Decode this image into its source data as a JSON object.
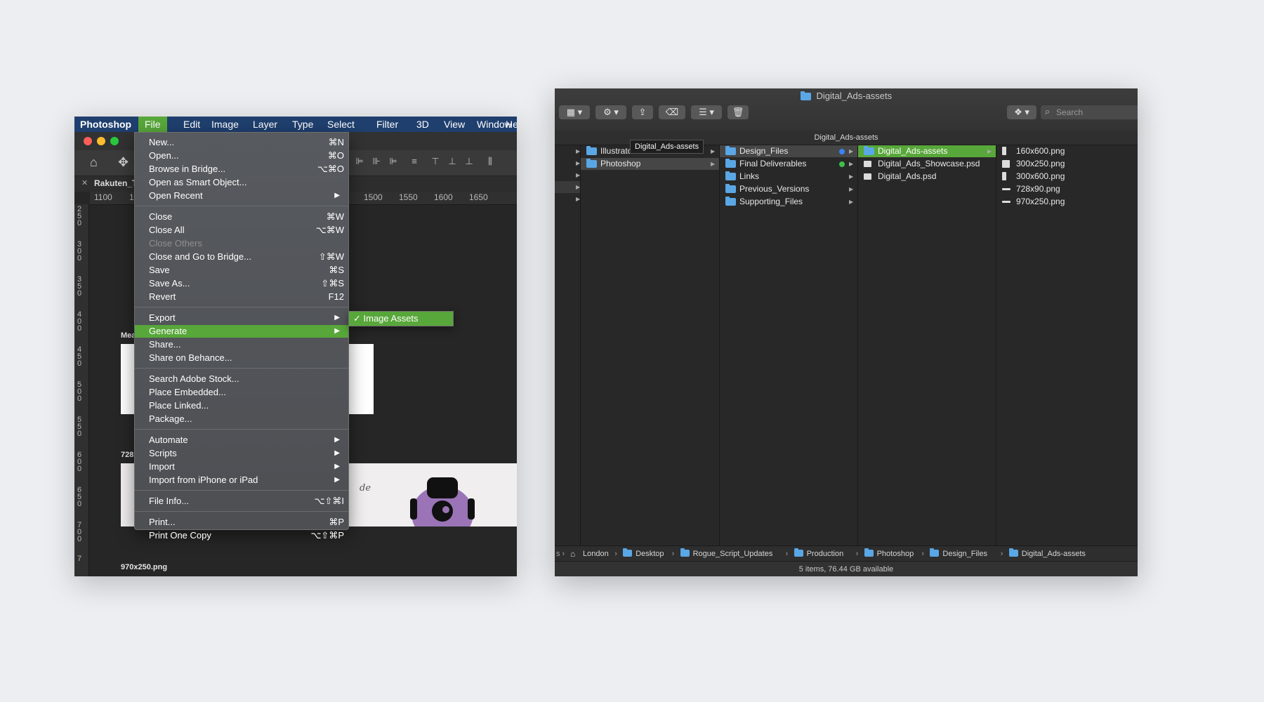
{
  "photoshop": {
    "menubar": [
      "Photoshop",
      "File",
      "Edit",
      "Image",
      "Layer",
      "Type",
      "Select",
      "Filter",
      "3D",
      "View",
      "Window",
      "He"
    ],
    "active_menu": "File",
    "document_tab": "Rakuten_Te",
    "ruler_h": [
      "1100",
      "115",
      "1500",
      "1550",
      "1600",
      "1650"
    ],
    "ruler_v": [
      "250",
      "300",
      "350",
      "400",
      "450",
      "500",
      "550",
      "600",
      "650",
      "700",
      "7"
    ],
    "canvas_labels": [
      "Meas",
      "728x",
      "970x250.png"
    ],
    "artboard_script_text": "de",
    "file_menu": [
      {
        "label": "New...",
        "shortcut": "⌘N"
      },
      {
        "label": "Open...",
        "shortcut": "⌘O"
      },
      {
        "label": "Browse in Bridge...",
        "shortcut": "⌥⌘O"
      },
      {
        "label": "Open as Smart Object...",
        "shortcut": ""
      },
      {
        "label": "Open Recent",
        "shortcut": "",
        "submenu": true
      },
      {
        "sep": true
      },
      {
        "label": "Close",
        "shortcut": "⌘W"
      },
      {
        "label": "Close All",
        "shortcut": "⌥⌘W"
      },
      {
        "label": "Close Others",
        "shortcut": "",
        "disabled": true
      },
      {
        "label": "Close and Go to Bridge...",
        "shortcut": "⇧⌘W"
      },
      {
        "label": "Save",
        "shortcut": "⌘S"
      },
      {
        "label": "Save As...",
        "shortcut": "⇧⌘S"
      },
      {
        "label": "Revert",
        "shortcut": "F12"
      },
      {
        "sep": true
      },
      {
        "label": "Export",
        "shortcut": "",
        "submenu": true
      },
      {
        "label": "Generate",
        "shortcut": "",
        "submenu": true,
        "highlight": true
      },
      {
        "label": "Share...",
        "shortcut": ""
      },
      {
        "label": "Share on Behance...",
        "shortcut": ""
      },
      {
        "sep": true
      },
      {
        "label": "Search Adobe Stock...",
        "shortcut": ""
      },
      {
        "label": "Place Embedded...",
        "shortcut": ""
      },
      {
        "label": "Place Linked...",
        "shortcut": ""
      },
      {
        "label": "Package...",
        "shortcut": ""
      },
      {
        "sep": true
      },
      {
        "label": "Automate",
        "shortcut": "",
        "submenu": true
      },
      {
        "label": "Scripts",
        "shortcut": "",
        "submenu": true
      },
      {
        "label": "Import",
        "shortcut": "",
        "submenu": true
      },
      {
        "label": "Import from iPhone or iPad",
        "shortcut": "",
        "submenu": true
      },
      {
        "sep": true
      },
      {
        "label": "File Info...",
        "shortcut": "⌥⇧⌘I"
      },
      {
        "sep": true
      },
      {
        "label": "Print...",
        "shortcut": "⌘P"
      },
      {
        "label": "Print One Copy",
        "shortcut": "⌥⇧⌘P"
      }
    ],
    "generate_submenu": {
      "label": "✓ Image Assets",
      "checked": true
    }
  },
  "finder": {
    "window_title": "Digital_Ads-assets",
    "path_title": "Digital_Ads-assets",
    "search_placeholder": "Search",
    "tooltip": "Digital_Ads-assets",
    "col1": [
      {
        "name": "Illustrator",
        "icon": "folder"
      },
      {
        "name": "Photoshop",
        "icon": "folder",
        "selected_inactive": true
      }
    ],
    "col2": [
      {
        "name": "Design_Files",
        "icon": "folder",
        "tag": "#3b82f6",
        "selected_inactive": true
      },
      {
        "name": "Final Deliverables",
        "icon": "folder",
        "tag": "#3cc24a"
      },
      {
        "name": "Links",
        "icon": "folder"
      },
      {
        "name": "Previous_Versions",
        "icon": "folder"
      },
      {
        "name": "Supporting_Files",
        "icon": "folder"
      }
    ],
    "col3": [
      {
        "name": "Digital_Ads-assets",
        "icon": "folder",
        "selected": true
      },
      {
        "name": "Digital_Ads_Showcase.psd",
        "icon": "psd"
      },
      {
        "name": "Digital_Ads.psd",
        "icon": "psd"
      }
    ],
    "col4": [
      {
        "name": "160x600.png",
        "icon": "tall"
      },
      {
        "name": "300x250.png",
        "icon": "square"
      },
      {
        "name": "300x600.png",
        "icon": "tall"
      },
      {
        "name": "728x90.png",
        "icon": "wide"
      },
      {
        "name": "970x250.png",
        "icon": "wide"
      }
    ],
    "breadcrumbs": [
      "London",
      "Desktop",
      "Rogue_Script_Updates",
      "Production",
      "Photoshop",
      "Design_Files",
      "Digital_Ads-assets"
    ],
    "status": "5 items, 76.44 GB available"
  },
  "colors": {
    "accent_green": "#58a73a",
    "folder_blue": "#5aa7e6",
    "menubar_blue": "#1f3f6e"
  }
}
